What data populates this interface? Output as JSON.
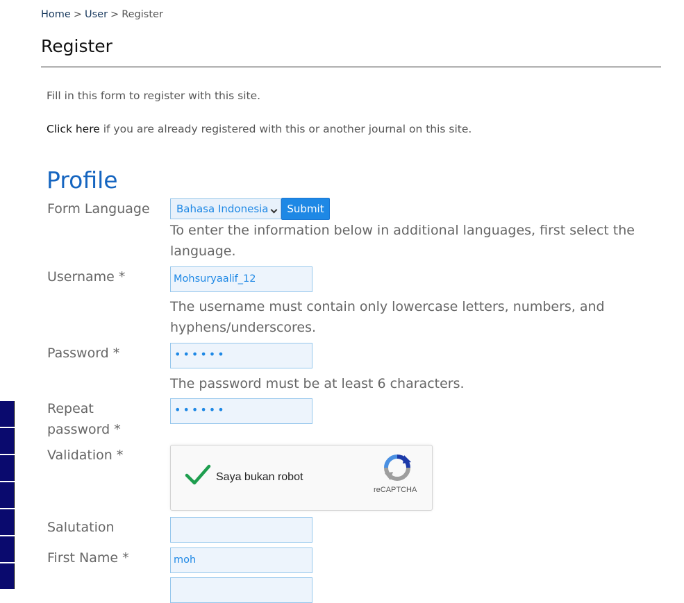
{
  "breadcrumb": {
    "home": "Home",
    "user": "User",
    "current": "Register",
    "separator": ">"
  },
  "page_title": "Register",
  "intro": "Fill in this form to register with this site.",
  "login_prompt": {
    "link": "Click here",
    "text": " if you are already registered with this or another journal on this site."
  },
  "section_title": "Profile",
  "form_language": {
    "label": "Form Language",
    "selected": "Bahasa Indonesia",
    "submit_label": "Submit",
    "hint": "To enter the information below in additional languages, first select the language."
  },
  "username": {
    "label": "Username *",
    "value": "Mohsuryaalif_12",
    "hint": "The username must contain only lowercase letters, numbers, and hyphens/underscores."
  },
  "password": {
    "label": "Password *",
    "masked_value": "••••••",
    "hint": "The password must be at least 6 characters."
  },
  "repeat_password": {
    "label_line1": "Repeat",
    "label_line2": "password *",
    "masked_value": "••••••"
  },
  "validation": {
    "label": "Validation *",
    "captcha_text": "Saya bukan robot",
    "captcha_brand": "reCAPTCHA"
  },
  "salutation": {
    "label": "Salutation",
    "value": ""
  },
  "first_name": {
    "label": "First Name *",
    "value": "moh"
  },
  "colors": {
    "accent": "#1e88e5",
    "heading": "#1565c0",
    "check": "#1e9e4f",
    "sidebar": "#0a0a6e"
  }
}
